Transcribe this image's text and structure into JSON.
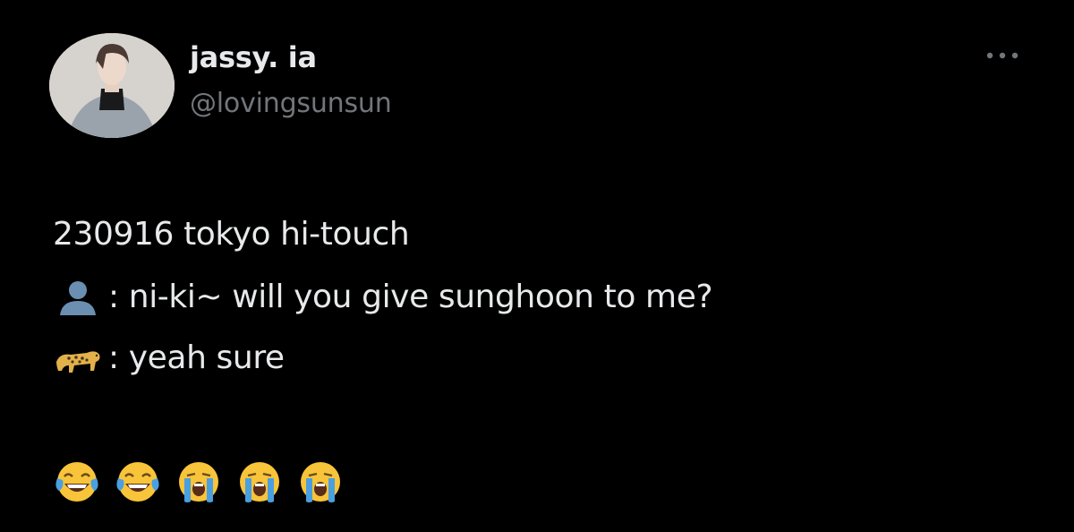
{
  "tweet": {
    "display_name": "jassy. ia",
    "handle": "@lovingsunsun",
    "more_label": "•••",
    "lines": [
      "230916 tokyo hi-touch",
      ": ni-ki~ will you give sunghoon to me?",
      ": yeah sure"
    ],
    "emojis": [
      "face-with-tears-of-joy",
      "face-with-tears-of-joy",
      "loudly-crying-face",
      "loudly-crying-face",
      "loudly-crying-face"
    ]
  },
  "colors": {
    "background": "#000000",
    "primary_text": "#e7e9ea",
    "secondary_text": "#71767b",
    "emoji_yellow": "#f8c43a",
    "tear_blue": "#4a9fe0"
  }
}
